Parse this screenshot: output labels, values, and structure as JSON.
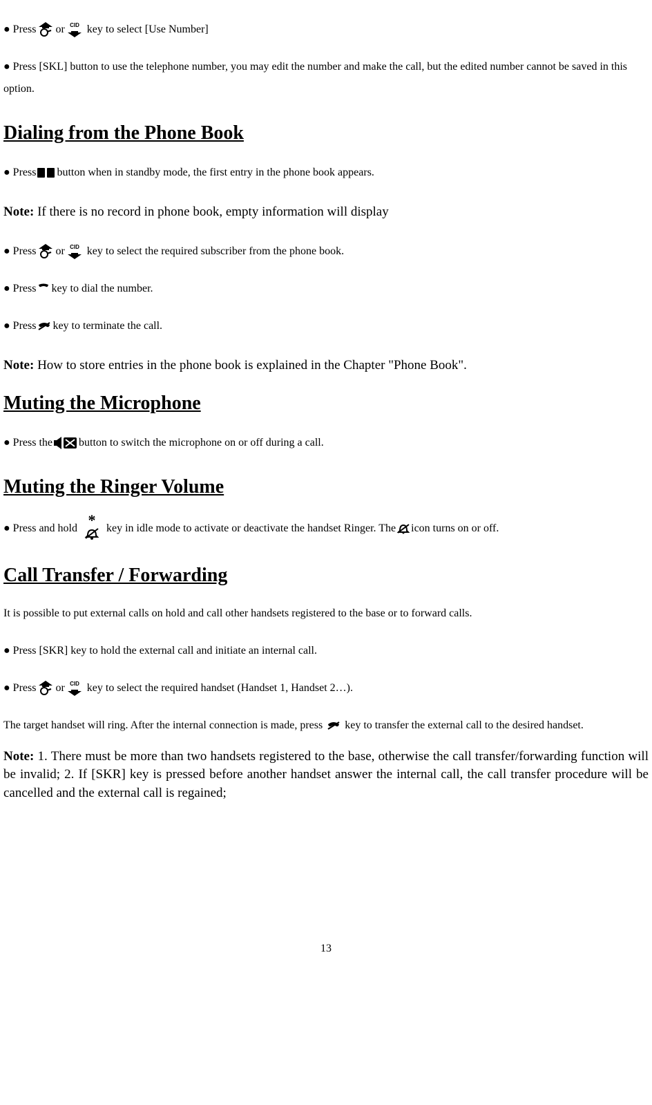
{
  "line1": {
    "pre": "● Press",
    "mid": " or ",
    "post": " key to select [Use Number]"
  },
  "line2": "● Press [SKL] button to use the telephone number, you may edit the number and make the call, but the edited number cannot be saved in this option.",
  "heading_dialing": "Dialing from the Phone Book",
  "dial_line1": {
    "pre": "●  Press",
    "post": " button when in standby mode, the first entry in the phone book appears."
  },
  "dial_note1": {
    "bold": "Note:",
    "text": " If there is no record in phone book, empty information will display"
  },
  "dial_line2": {
    "pre": "●  Press ",
    "mid": " or ",
    "post": " key to select the required subscriber from the phone book."
  },
  "dial_line3": {
    "pre": "●  Press  ",
    "post": " key to dial the number."
  },
  "dial_line4": {
    "pre": "●  Press  ",
    "post": " key to terminate the call."
  },
  "dial_note2": {
    "bold": "Note:",
    "text": " How to store entries in the phone book is explained in the Chapter \"Phone Book\"."
  },
  "heading_muting_mic": "Muting the Microphone",
  "mute_mic_line": {
    "pre": "●  Press the ",
    "post": " button to switch the microphone on or off during a call."
  },
  "heading_muting_ringer": "Muting the Ringer Volume",
  "mute_ringer_line": {
    "pre": "●  Press and hold ",
    "mid": " key in idle mode to activate or deactivate the handset Ringer. The ",
    "post": " icon turns on or off."
  },
  "heading_transfer": "Call Transfer / Forwarding",
  "transfer_intro": "It is possible to put external calls on hold and call other handsets registered to the base or to forward calls.",
  "transfer_line1": "●  Press [SKR] key to hold the external call and initiate an internal call.",
  "transfer_line2": {
    "pre": "●  Press ",
    "mid": " or ",
    "post": " key to select the required handset (Handset 1, Handset 2…)."
  },
  "transfer_line3": {
    "pre": "The target handset will ring. After the internal connection is made, press  ",
    "post": "  key to transfer the external call to the desired handset."
  },
  "transfer_note": {
    "bold": "Note:",
    "text": " 1. There must be more than two handsets registered to the base, otherwise the call transfer/forwarding function will be invalid; 2. If [SKR] key is pressed before another handset answer the internal call, the call transfer procedure will be cancelled and the external call is regained;"
  },
  "page_number": "13"
}
